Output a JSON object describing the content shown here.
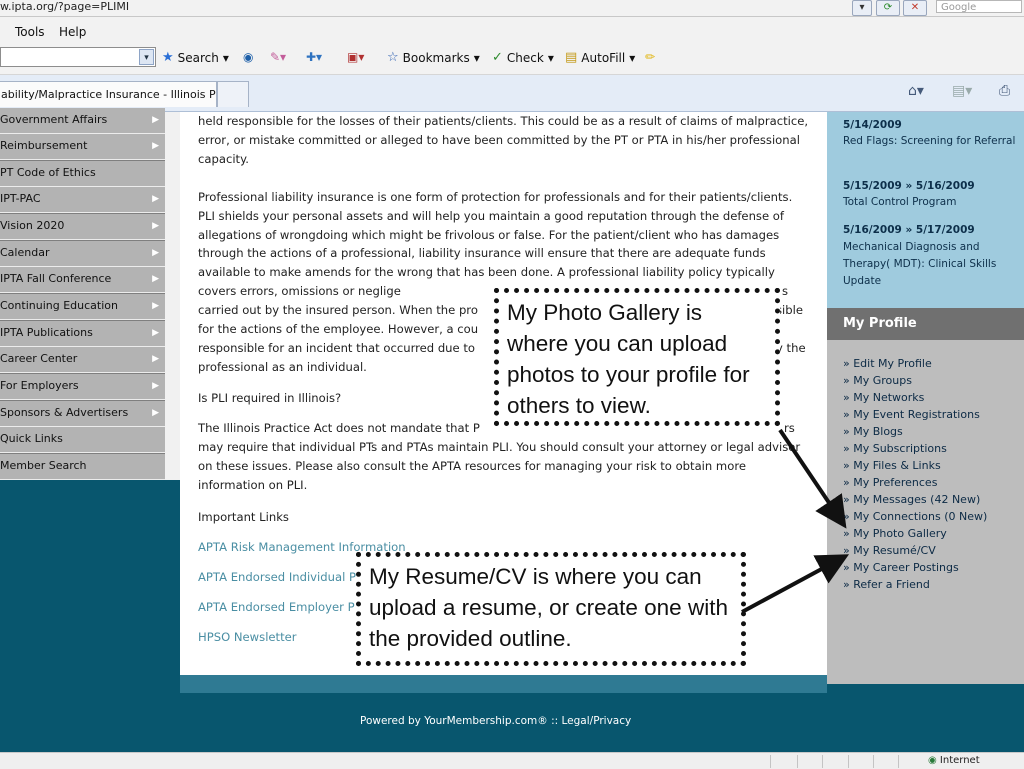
{
  "browser": {
    "address": "w.ipta.org/?page=PLIMI",
    "search_placeholder": "Google",
    "menu": [
      "Tools",
      "Help"
    ],
    "toolbar": {
      "search_label": "Search",
      "bookmarks_label": "Bookmarks",
      "check_label": "Check",
      "autofill_label": "AutoFill"
    },
    "tab_title": "ability/Malpractice Insurance - Illinois Ph..."
  },
  "nav": {
    "items": [
      {
        "label": "Government Affairs",
        "has_arrow": true
      },
      {
        "label": "Reimbursement",
        "has_arrow": true
      },
      {
        "label": "PT Code of Ethics",
        "has_arrow": false
      },
      {
        "label": "IPT-PAC",
        "has_arrow": true
      },
      {
        "label": "Vision 2020",
        "has_arrow": true
      },
      {
        "label": "Calendar",
        "has_arrow": true
      },
      {
        "label": "IPTA Fall Conference",
        "has_arrow": true
      },
      {
        "label": "Continuing Education",
        "has_arrow": true
      },
      {
        "label": "IPTA Publications",
        "has_arrow": true
      },
      {
        "label": "Career Center",
        "has_arrow": true
      },
      {
        "label": "For Employers",
        "has_arrow": true
      },
      {
        "label": "Sponsors & Advertisers",
        "has_arrow": true
      },
      {
        "label": "Quick Links",
        "has_arrow": false
      },
      {
        "label": "Member Search",
        "has_arrow": false
      }
    ]
  },
  "content": {
    "para1": "held responsible for the losses of their patients/clients. This could be as a result of claims of malpractice, error, or mistake committed or alleged to have been committed by the PT or PTA in his/her professional capacity.",
    "para2": "Professional liability insurance is one form of protection for professionals and for their patients/clients. PLI shields your personal assets and will help you maintain a good reputation through the defense of allegations of wrongdoing which might be frivolous or false. For the patient/client who has damages through the actions of a professional, liability insurance will ensure that there are adequate funds available to make amends for the wrong that has been done. A professional liability policy typically covers errors, omissions or neglige",
    "para2_b": "s",
    "para2_c": "carried out by the insured person. When the pro",
    "para2_d": "sible",
    "para2_e": "for the actions of the employee. However, a cou",
    "para2_f": "responsible for an incident that occurred due to",
    "para2_g": "y the",
    "para2_h": "professional as an individual.",
    "question": "Is PLI required in Illinois?",
    "para3_a": "The Illinois Practice Act does not mandate that P",
    "para3_b": "rs",
    "para3_rest": "may require that individual PTs and PTAs maintain PLI. You should consult your attorney or legal advisor on these issues. Please also consult the APTA resources for managing your risk to obtain more information on PLI.",
    "important_links_heading": "Important Links",
    "links": [
      "APTA Risk Management Information",
      "APTA Endorsed Individual P",
      "APTA Endorsed Employer P",
      "HPSO Newsletter"
    ]
  },
  "events": [
    {
      "date": "5/14/2009",
      "title": "Red Flags: Screening for Referral"
    },
    {
      "date": "5/15/2009 » 5/16/2009",
      "title": "Total Control Program"
    },
    {
      "date": "5/16/2009 » 5/17/2009",
      "title": "Mechanical Diagnosis and Therapy( MDT): Clinical Skills Update"
    }
  ],
  "profile": {
    "heading": "My Profile",
    "links": [
      "» Edit My Profile",
      "» My Groups",
      "» My Networks",
      "» My Event Registrations",
      "» My Blogs",
      "» My Subscriptions",
      "» My Files & Links",
      "» My Preferences",
      "» My Messages (42 New)",
      "» My Connections (0 New)",
      "» My Photo Gallery",
      "» My Resumé/CV",
      "» My Career Postings",
      "» Refer a Friend"
    ]
  },
  "footer": {
    "powered_by": "Powered by YourMembership.com®  ::  Legal/Privacy"
  },
  "status": {
    "zone": "Internet"
  },
  "callouts": {
    "gallery": "My Photo Gallery is where you can upload photos to your profile for others to view.",
    "resume": "My Resume/CV is where you can upload a resume, or create one with the provided outline."
  },
  "colors": {
    "page_bg": "#08566e",
    "nav_bg": "#b3b3b3",
    "events_bg": "#9fcbde",
    "profile_heading_bg": "#707070",
    "link": "#4a8ea3"
  }
}
